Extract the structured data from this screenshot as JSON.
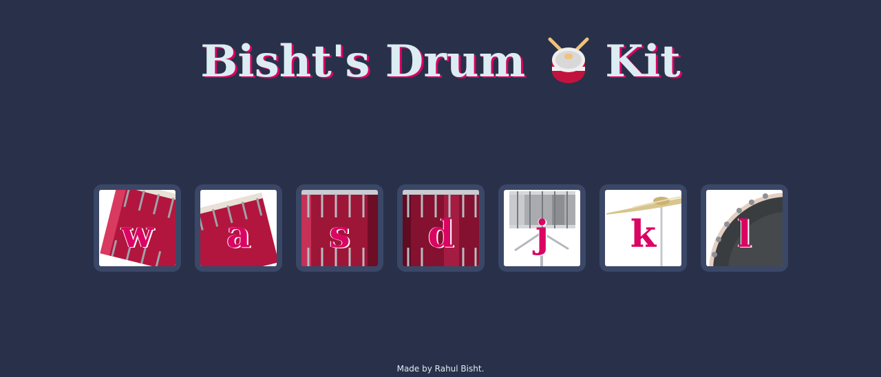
{
  "header": {
    "title_before": "Bisht's Drum",
    "title_after": "Kit",
    "title_icon": "drum-icon"
  },
  "pads": [
    {
      "key": "w",
      "art": "tom-tilted-left"
    },
    {
      "key": "a",
      "art": "tom-tilted-right"
    },
    {
      "key": "s",
      "art": "floor-tom"
    },
    {
      "key": "d",
      "art": "floor-tom-dark"
    },
    {
      "key": "j",
      "art": "snare-on-stand"
    },
    {
      "key": "k",
      "art": "crash-cymbal"
    },
    {
      "key": "l",
      "art": "bass-drum"
    }
  ],
  "footer": {
    "text": "Made by Rahul Bisht."
  },
  "colors": {
    "background": "#283149",
    "title_text": "#DBEDF3",
    "accent": "#DA0463",
    "pad_frame": "#3b4766"
  }
}
